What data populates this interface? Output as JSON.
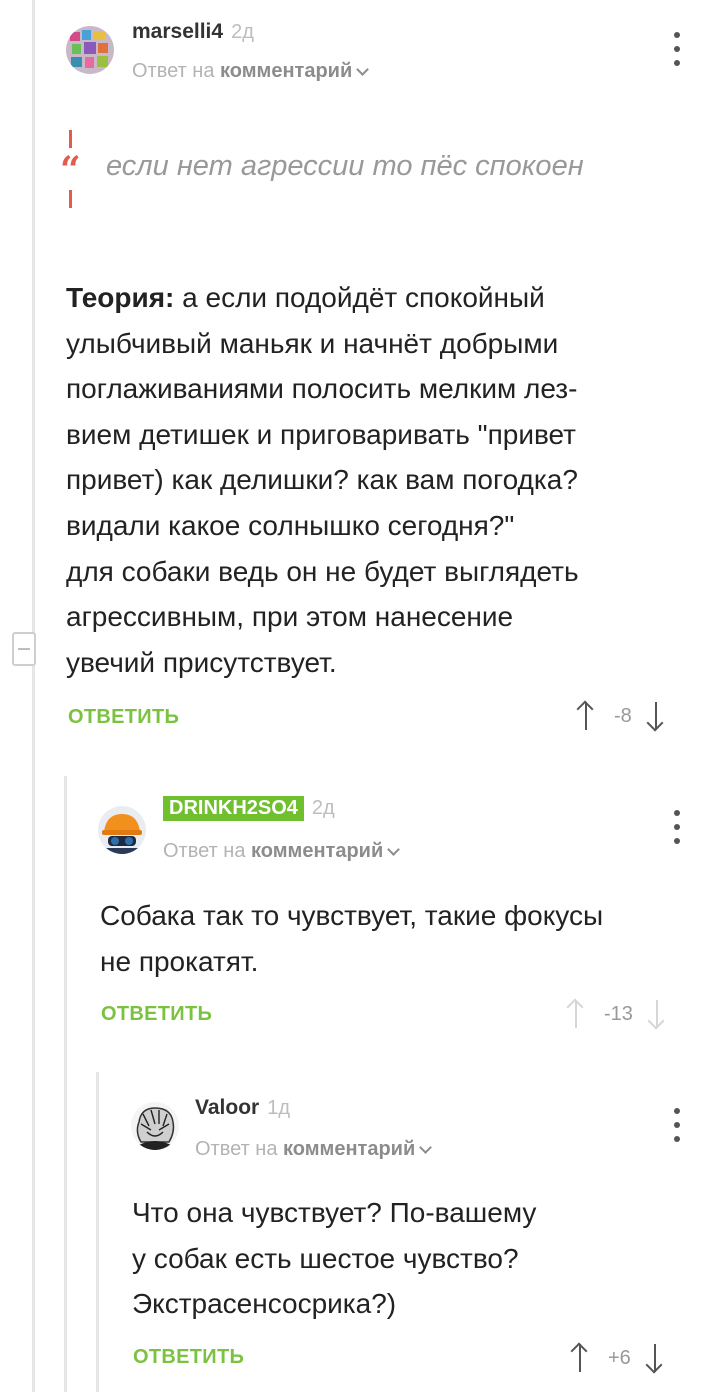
{
  "comments": [
    {
      "author": "marselli4",
      "time": "2д",
      "reply_prefix": "Ответ на",
      "reply_target": "комментарий",
      "quote": "если нет агрессии то пёс спокоен",
      "body_lead": "Теория:",
      "body_lines": [
        "а если подойдёт спокойный",
        "улыбчивый маньяк и начнёт добрыми",
        "поглаживаниями полосить мелким лез-",
        "вием детишек и приговаривать \"привет",
        "привет) как делишки? как вам погодка?",
        "видали какое солнышко сегодня?\"",
        "для собаки ведь он не будет выглядеть",
        "агрессивным, при этом нанесение",
        "увечий присутствует."
      ],
      "reply_label": "ОТВЕТИТЬ",
      "score": "-8"
    },
    {
      "author": "DRINKH2SO4",
      "time": "2д",
      "reply_prefix": "Ответ на",
      "reply_target": "комментарий",
      "body_lines": [
        "Собака так то чувствует, такие фокусы",
        "не прокатят."
      ],
      "reply_label": "ОТВЕТИТЬ",
      "score": "-13"
    },
    {
      "author": "Valoor",
      "time": "1д",
      "reply_prefix": "Ответ на",
      "reply_target": "комментарий",
      "body_lines": [
        "Что она чувствует? По-вашему",
        "у собак есть шестое чувство?",
        "Экстрасенсосрика?)"
      ],
      "reply_label": "ОТВЕТИТЬ",
      "score": "+6"
    }
  ],
  "icons": {
    "more": "more-vertical-icon",
    "upvote": "arrow-up-icon",
    "downvote": "arrow-down-icon",
    "collapse": "minus-icon",
    "quote": "quote-icon",
    "chevron": "chevron-down-icon"
  },
  "colors": {
    "accent_green": "#7cc241",
    "badge_green": "#6fbf2f",
    "quote_red": "#e35b4a"
  }
}
